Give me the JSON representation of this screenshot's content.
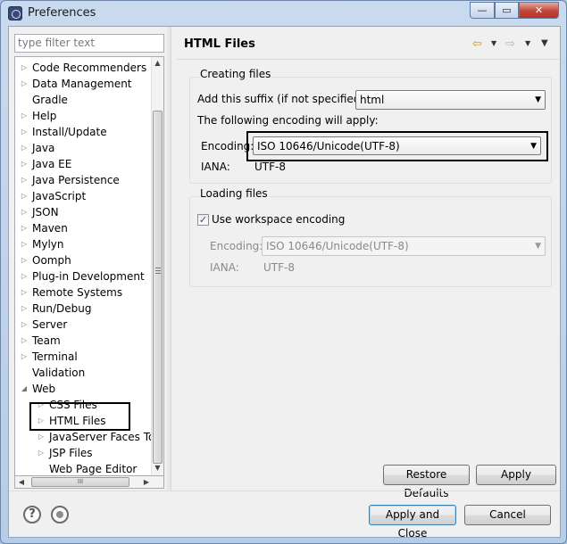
{
  "window": {
    "title": "Preferences",
    "minimize_glyph": "—",
    "maximize_glyph": "▭",
    "close_glyph": "✕"
  },
  "filter": {
    "placeholder": "type filter text"
  },
  "tree": {
    "items": [
      {
        "label": "Code Recommenders",
        "twisty": "▷",
        "indent": 0
      },
      {
        "label": "Data Management",
        "twisty": "▷",
        "indent": 0
      },
      {
        "label": "Gradle",
        "twisty": "",
        "indent": 0
      },
      {
        "label": "Help",
        "twisty": "▷",
        "indent": 0
      },
      {
        "label": "Install/Update",
        "twisty": "▷",
        "indent": 0
      },
      {
        "label": "Java",
        "twisty": "▷",
        "indent": 0
      },
      {
        "label": "Java EE",
        "twisty": "▷",
        "indent": 0
      },
      {
        "label": "Java Persistence",
        "twisty": "▷",
        "indent": 0
      },
      {
        "label": "JavaScript",
        "twisty": "▷",
        "indent": 0
      },
      {
        "label": "JSON",
        "twisty": "▷",
        "indent": 0
      },
      {
        "label": "Maven",
        "twisty": "▷",
        "indent": 0
      },
      {
        "label": "Mylyn",
        "twisty": "▷",
        "indent": 0
      },
      {
        "label": "Oomph",
        "twisty": "▷",
        "indent": 0
      },
      {
        "label": "Plug-in Development",
        "twisty": "▷",
        "indent": 0
      },
      {
        "label": "Remote Systems",
        "twisty": "▷",
        "indent": 0
      },
      {
        "label": "Run/Debug",
        "twisty": "▷",
        "indent": 0
      },
      {
        "label": "Server",
        "twisty": "▷",
        "indent": 0
      },
      {
        "label": "Team",
        "twisty": "▷",
        "indent": 0
      },
      {
        "label": "Terminal",
        "twisty": "▷",
        "indent": 0
      },
      {
        "label": "Validation",
        "twisty": "",
        "indent": 0
      },
      {
        "label": "Web",
        "twisty": "◢",
        "indent": 0
      },
      {
        "label": "CSS Files",
        "twisty": "▷",
        "indent": 1
      },
      {
        "label": "HTML Files",
        "twisty": "▷",
        "indent": 1
      },
      {
        "label": "JavaServer Faces To",
        "twisty": "▷",
        "indent": 1
      },
      {
        "label": "JSP Files",
        "twisty": "▷",
        "indent": 1
      },
      {
        "label": "Web Page Editor",
        "twisty": "",
        "indent": 1
      }
    ],
    "scroll_up": "▲",
    "scroll_down": "▼",
    "scroll_left": "◀",
    "scroll_right": "▶",
    "hthumb_grip": "III"
  },
  "page": {
    "title": "HTML Files",
    "back_glyph": "⇦",
    "forward_glyph": "⇨",
    "menu_glyph": "▼"
  },
  "creating": {
    "group_label": "Creating files",
    "suffix_label": "Add this suffix (if not specified):",
    "suffix_value": "html",
    "encoding_note": "The following encoding will apply:",
    "encoding_label": "Encoding:",
    "encoding_value": "ISO 10646/Unicode(UTF-8)",
    "iana_label": "IANA:",
    "iana_value": "UTF-8"
  },
  "loading": {
    "group_label": "Loading files",
    "use_workspace_label": "Use workspace encoding",
    "use_workspace_checked": true,
    "checkmark": "✓",
    "encoding_label": "Encoding:",
    "encoding_value": "ISO 10646/Unicode(UTF-8)",
    "iana_label": "IANA:",
    "iana_value": "UTF-8"
  },
  "buttons": {
    "restore_defaults": "Restore Defaults",
    "apply": "Apply",
    "apply_and_close": "Apply and Close",
    "cancel": "Cancel"
  },
  "footer": {
    "help_glyph": "?"
  },
  "colors": {
    "selection_outline": "#000000",
    "nav_arrow": "#c79a1e"
  }
}
